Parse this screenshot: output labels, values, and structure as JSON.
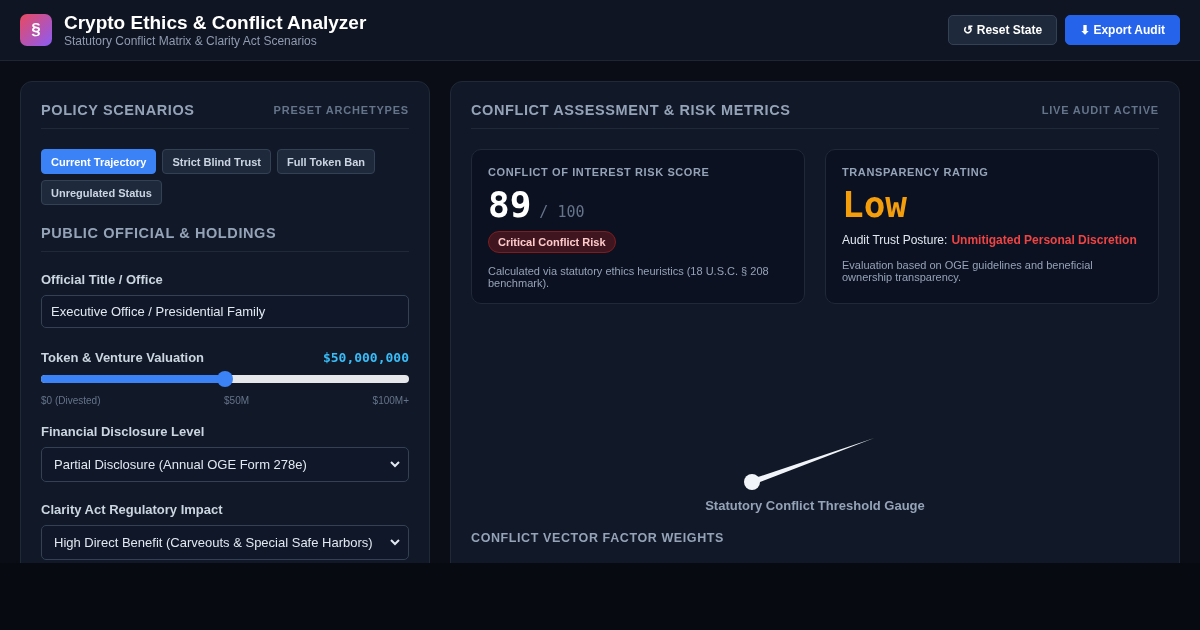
{
  "header": {
    "logo": "§",
    "title": "Crypto Ethics & Conflict Analyzer",
    "subtitle": "Statutory Conflict Matrix & Clarity Act Scenarios",
    "buttons": [
      {
        "label": "↺ Reset State",
        "kind": "secondary"
      },
      {
        "label": "⬇ Export Audit",
        "kind": "primary"
      }
    ]
  },
  "left_panel": {
    "title": "POLICY SCENARIOS",
    "tag": "PRESET ARCHETYPES",
    "scenarios": [
      {
        "label": "Current Trajectory",
        "selected": true
      },
      {
        "label": "Strict Blind Trust",
        "selected": false
      },
      {
        "label": "Full Token Ban",
        "selected": false
      },
      {
        "label": "Unregulated Status",
        "selected": false
      }
    ],
    "section_title": "PUBLIC OFFICIAL & HOLDINGS",
    "office": {
      "label": "Official Title / Office",
      "value": "Executive Office / Presidential Family"
    },
    "valuation": {
      "label": "Token & Venture Valuation",
      "reading": "$50,000,000",
      "level": 0.5,
      "ticks": [
        "$0 (Divested)",
        "$50M",
        "$100M+"
      ]
    },
    "disclosure": {
      "label": "Financial Disclosure Level",
      "value": "Partial Disclosure (Annual OGE Form 278e)"
    },
    "clarity": {
      "label": "Clarity Act Regulatory Impact",
      "value": "High Direct Benefit (Carveouts & Special Safe Harbors)"
    }
  },
  "right_panel": {
    "title": "CONFLICT ASSESSMENT & RISK METRICS",
    "tag": "LIVE AUDIT ACTIVE",
    "score_card": {
      "title": "CONFLICT OF INTEREST RISK SCORE",
      "score": "89",
      "out_of": "/ 100",
      "badge": "Critical Conflict Risk",
      "note": "Calculated via statutory ethics heuristics (18 U.S.C. § 208 benchmark)."
    },
    "transparency_card": {
      "title": "TRANSPARENCY RATING",
      "rating": "Low",
      "posture_label": "Audit Trust Posture:",
      "posture_value": "Unmitigated Personal Discretion",
      "note": "Evaluation based on OGE guidelines and beneficial ownership transparency."
    },
    "gauge": {
      "level": 0.89,
      "caption": "Statutory Conflict Threshold Gauge"
    },
    "weights_title": "CONFLICT VECTOR FACTOR WEIGHTS"
  }
}
